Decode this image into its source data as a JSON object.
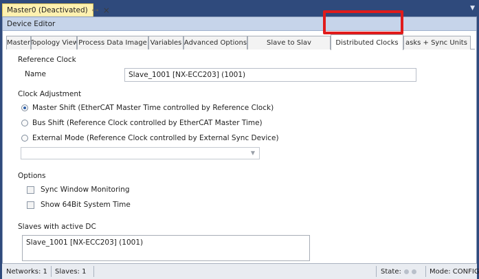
{
  "document_tab": {
    "title": "Master0 (Deactivated)",
    "pin_icon": "pin-icon",
    "close_icon": "close-icon"
  },
  "editor": {
    "header": "Device Editor"
  },
  "tabs": [
    {
      "label": "Master"
    },
    {
      "label": "Topology View"
    },
    {
      "label": "Process Data Image"
    },
    {
      "label": "Variables"
    },
    {
      "label": "Advanced Options"
    },
    {
      "label": "Slave to Slav"
    },
    {
      "label": "Distributed Clocks",
      "active": true
    },
    {
      "label": "asks + Sync Units"
    }
  ],
  "highlight_color": "#e01b1b",
  "reference_clock": {
    "title": "Reference Clock",
    "name_label": "Name",
    "name_value": "Slave_1001 [NX-ECC203] (1001)"
  },
  "clock_adjustment": {
    "title": "Clock Adjustment",
    "options": [
      {
        "label": "Master Shift (EtherCAT Master Time controlled by Reference Clock)",
        "selected": true
      },
      {
        "label": "Bus Shift (Reference Clock controlled by EtherCAT Master Time)",
        "selected": false
      },
      {
        "label": "External Mode (Reference Clock controlled by External Sync Device)",
        "selected": false
      }
    ],
    "external_device_select": ""
  },
  "options": {
    "title": "Options",
    "checkboxes": [
      {
        "label": "Sync Window Monitoring",
        "checked": false
      },
      {
        "label": "Show 64Bit System Time",
        "checked": false
      }
    ]
  },
  "slaves_dc": {
    "title": "Slaves with active DC",
    "items": [
      "Slave_1001 [NX-ECC203] (1001)"
    ]
  },
  "statusbar": {
    "networks": "Networks: 1",
    "slaves": "Slaves: 1",
    "state": "State:",
    "mode": "Mode: CONFIG"
  }
}
